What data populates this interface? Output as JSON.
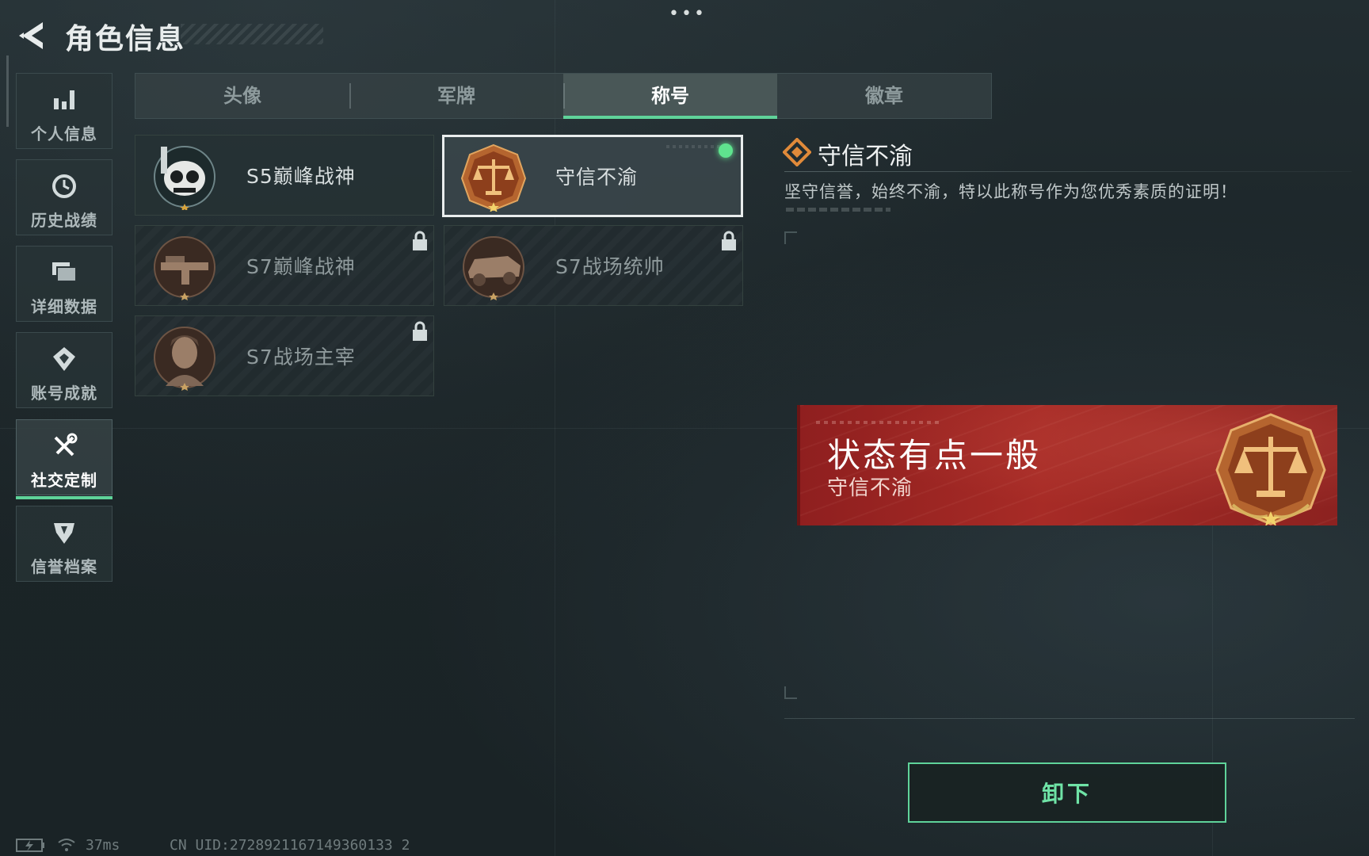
{
  "header": {
    "title": "角色信息",
    "back_icon": "chevron-left-icon",
    "more_icon": "more-dots-icon"
  },
  "nav": {
    "items": [
      {
        "label": "个人信息",
        "icon": "bar-chart-icon",
        "active": false
      },
      {
        "label": "历史战绩",
        "icon": "history-clock-icon",
        "active": false
      },
      {
        "label": "详细数据",
        "icon": "stacked-folders-icon",
        "active": false
      },
      {
        "label": "账号成就",
        "icon": "medal-icon",
        "active": false
      },
      {
        "label": "社交定制",
        "icon": "tools-icon",
        "active": true
      },
      {
        "label": "信誉档案",
        "icon": "shield-icon",
        "active": false
      }
    ]
  },
  "tabs": {
    "items": [
      {
        "label": "头像",
        "active": false
      },
      {
        "label": "军牌",
        "active": false
      },
      {
        "label": "称号",
        "active": true
      },
      {
        "label": "徽章",
        "active": false
      }
    ]
  },
  "titles": {
    "items": [
      {
        "label": "S5巅峰战神",
        "emblem": "diver-skull-emblem",
        "locked": false,
        "selected": false
      },
      {
        "label": "守信不渝",
        "emblem": "scales-emblem",
        "locked": false,
        "selected": true,
        "equipped": true
      },
      {
        "label": "S7巅峰战神",
        "emblem": "rifle-emblem",
        "locked": true,
        "selected": false
      },
      {
        "label": "S7战场统帅",
        "emblem": "vehicle-emblem",
        "locked": true,
        "selected": false
      },
      {
        "label": "S7战场主宰",
        "emblem": "soldier-portrait-emblem",
        "locked": true,
        "selected": false
      }
    ]
  },
  "detail": {
    "icon": "diamond-ornament-icon",
    "title": "守信不渝",
    "description": "坚守信誉，始终不渝，特以此称号作为您优秀素质的证明！"
  },
  "preview": {
    "status": "状态有点一般",
    "subtitle": "守信不渝",
    "emblem": "scales-emblem"
  },
  "actions": {
    "unequip_label": "卸下"
  },
  "status_bar": {
    "battery_icon": "battery-charging-icon",
    "wifi_icon": "wifi-icon",
    "ping": "37ms",
    "uid": "CN UID:2728921167149360133 2"
  },
  "colors": {
    "accent_green": "#5fd39a",
    "banner_red": "#a72b26",
    "emblem_bronze": "#b5652f"
  }
}
